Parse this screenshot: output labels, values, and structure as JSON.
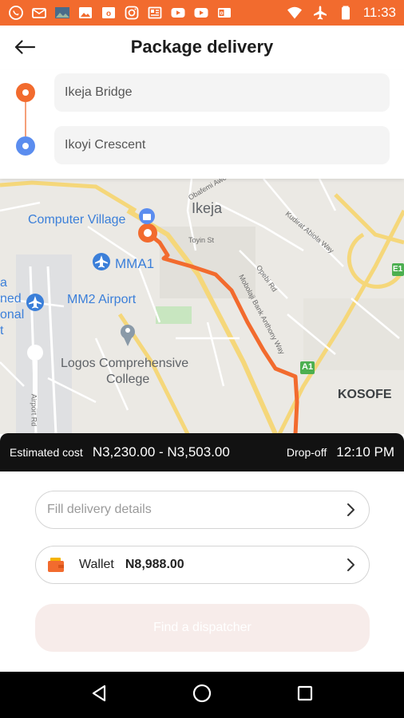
{
  "status_bar": {
    "time": "11:33",
    "left_icons": [
      "whatsapp-icon",
      "email-icon",
      "photo-thumbnail-icon",
      "gallery-icon",
      "outlook-icon",
      "instagram-icon",
      "news-icon",
      "youtube-icon",
      "youtube-icon",
      "outlook-mail-icon"
    ],
    "right_icons": [
      "wifi-icon",
      "airplane-mode-icon",
      "battery-icon"
    ]
  },
  "header": {
    "title": "Package delivery",
    "back_icon": "back-arrow-icon"
  },
  "route": {
    "pickup": "Ikeja Bridge",
    "dropoff": "Ikoyi Crescent"
  },
  "map": {
    "labels": {
      "computer_village": "Computer Village",
      "ikeja": "Ikeja",
      "mma1": "MMA1",
      "mm2_airport": "MM2 Airport",
      "logos_line1": "Logos Comprehensive",
      "logos_line2": "College",
      "kosofe": "KOSOFE",
      "a1": "A1",
      "e1": "E1",
      "obafemi_awolowo": "Obafemi Awo",
      "toyin_st": "Toyin St",
      "kudirat_abiola_way": "Kudirat Abiola Way",
      "opebi_rd": "Opebi Rd",
      "mobolaji_bank_anthony": "Mobolaji Bank Anthony Way",
      "airport_rd": "Airport Rd",
      "left_fragments": [
        "a",
        "ned",
        "onal",
        "t"
      ]
    }
  },
  "estimate": {
    "label": "Estimated cost",
    "value": "N3,230.00 - N3,503.00",
    "dropoff_label": "Drop-off",
    "dropoff_time": "12:10 PM"
  },
  "sheet": {
    "details_placeholder": "Fill delivery details",
    "wallet_label": "Wallet",
    "wallet_balance": "N8,988.00",
    "find_button": "Find a dispatcher"
  },
  "colors": {
    "accent": "#f26b2e",
    "dropoff_dot": "#5b8def",
    "route_line": "#f26b2e",
    "estimate_bar": "#121212"
  }
}
